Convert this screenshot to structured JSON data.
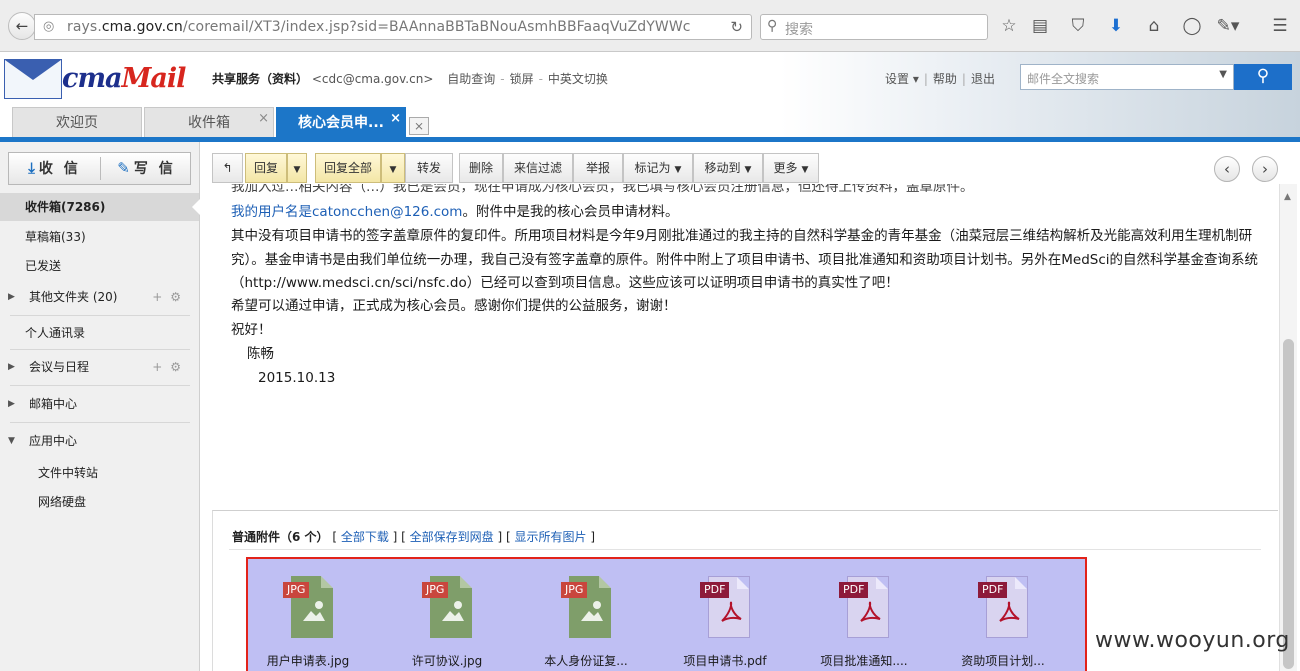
{
  "browser": {
    "url_prefix": "rays.",
    "url_domain": "cma.gov.cn",
    "url_path": "/coremail/XT3/index.jsp?sid=BAAnnaBBTaBNouAsmhBBFaaqVuZdYWWc",
    "search_placeholder": "搜索"
  },
  "header": {
    "logo_text_a": "cma",
    "logo_text_b": "Mail",
    "service": "共享服务（资料）",
    "email": "<cdc@cma.gov.cn>",
    "links": [
      "自助查询",
      "锁屏",
      "中英文切换"
    ],
    "right_links": [
      "设置 ▾",
      "帮助",
      "退出"
    ],
    "search_placeholder": "邮件全文搜索"
  },
  "tabs": [
    {
      "label": "欢迎页"
    },
    {
      "label": "收件箱"
    },
    {
      "label": "核心会员申..."
    }
  ],
  "sidebar": {
    "receive_label": "收 信",
    "compose_label": "写 信",
    "items": [
      {
        "label": "收件箱(7286)"
      },
      {
        "label": "草稿箱(33)"
      },
      {
        "label": "已发送"
      },
      {
        "label": "其他文件夹 (20)"
      },
      {
        "label": "个人通讯录"
      },
      {
        "label": "会议与日程"
      },
      {
        "label": "邮箱中心"
      },
      {
        "label": "应用中心"
      }
    ],
    "sub_items": [
      {
        "label": "文件中转站"
      },
      {
        "label": "网络硬盘"
      }
    ]
  },
  "toolbar": {
    "back": "↰",
    "reply": "回复",
    "reply_all": "回复全部",
    "forward": "转发",
    "delete": "删除",
    "filter": "来信过滤",
    "report": "举报",
    "mark_as": "标记为",
    "move_to": "移动到",
    "more": "更多"
  },
  "mail": {
    "line0": "我加入过…相关内容（…）我已是会员，现在申请成为核心会员，我已填写核心会员注册信息，但还待上传资料，盖章原件。",
    "line1_link": "我的用户名是catoncchen@126.com",
    "line1_rest": "。附件中是我的核心会员申请材料。",
    "para2": "其中没有项目申请书的签字盖章原件的复印件。所用项目材料是今年9月刚批准通过的我主持的自然科学基金的青年基金（油菜冠层三维结构解析及光能高效利用生理机制研究）。基金申请书是由我们单位统一办理，我自己没有签字盖章的原件。附件中附上了项目申请书、项目批准通知和资助项目计划书。另外在MedSci的自然科学基金查询系统（http://www.medsci.cn/sci/nsfc.do）已经可以查到项目信息。这些应该可以证明项目申请书的真实性了吧！",
    "line3": "希望可以通过申请，正式成为核心会员。感谢你们提供的公益服务，谢谢！",
    "line4": "祝好！",
    "sign": "陈畅",
    "date": "2015.10.13"
  },
  "attachments": {
    "title": "普通附件（6 个）",
    "download_all": "全部下载",
    "save_all": "全部保存到网盘",
    "show_images": "显示所有图片",
    "items": [
      {
        "type": "JPG",
        "name": "用户申请表.jpg"
      },
      {
        "type": "JPG",
        "name": "许可协议.jpg"
      },
      {
        "type": "JPG",
        "name": "本人身份证复..."
      },
      {
        "type": "PDF",
        "name": "项目申请书.pdf"
      },
      {
        "type": "PDF",
        "name": "项目批准通知...."
      },
      {
        "type": "PDF",
        "name": "资助项目计划..."
      }
    ]
  },
  "watermark": "www.wooyun.org",
  "colors": {
    "accent": "#1c76c8",
    "highlight_border": "#e2231a",
    "attachment_bg": "#bfbff3"
  }
}
